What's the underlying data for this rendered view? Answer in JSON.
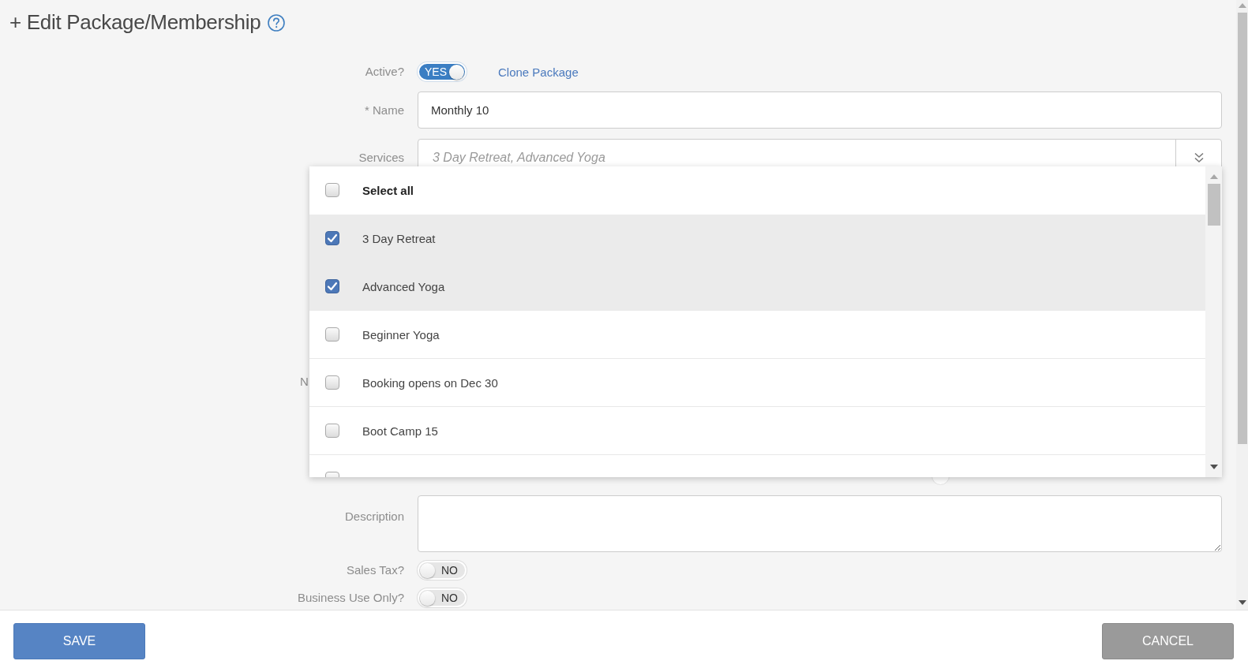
{
  "header": {
    "title": "+ Edit Package/Membership"
  },
  "fields": [
    {
      "kind": "toggle",
      "label": "Active?",
      "on": true,
      "text": "YES",
      "link": "Clone Package"
    },
    {
      "kind": "text",
      "label": "* Name",
      "value": "Monthly 10"
    },
    {
      "kind": "multiselect",
      "label": "Services",
      "value": "3 Day Retreat, Advanced Yoga",
      "expanded": true,
      "dropdown": {
        "select_all": {
          "label": "Select all",
          "checked": false
        },
        "options": [
          {
            "label": "3 Day Retreat",
            "checked": true
          },
          {
            "label": "Advanced Yoga",
            "checked": true
          },
          {
            "label": "Beginner Yoga",
            "checked": false
          },
          {
            "label": "Booking opens on Dec 30",
            "checked": false
          },
          {
            "label": "Boot Camp 15",
            "checked": false
          },
          {
            "checked": false
          }
        ]
      }
    },
    {
      "kind": "label_only",
      "label": "N"
    },
    {
      "kind": "radio",
      "options": [
        {
          "selected": false
        }
      ]
    },
    {
      "kind": "textarea",
      "label": "Description"
    },
    {
      "kind": "toggle",
      "label": "Sales Tax?",
      "on": false,
      "text": "NO"
    },
    {
      "kind": "toggle",
      "label": "Business Use Only?",
      "on": false,
      "text": "NO"
    }
  ],
  "footer": {
    "buttons": [
      {
        "kind": "primary",
        "label": "SAVE"
      },
      {
        "kind": "secondary",
        "label": "CANCEL"
      }
    ]
  }
}
